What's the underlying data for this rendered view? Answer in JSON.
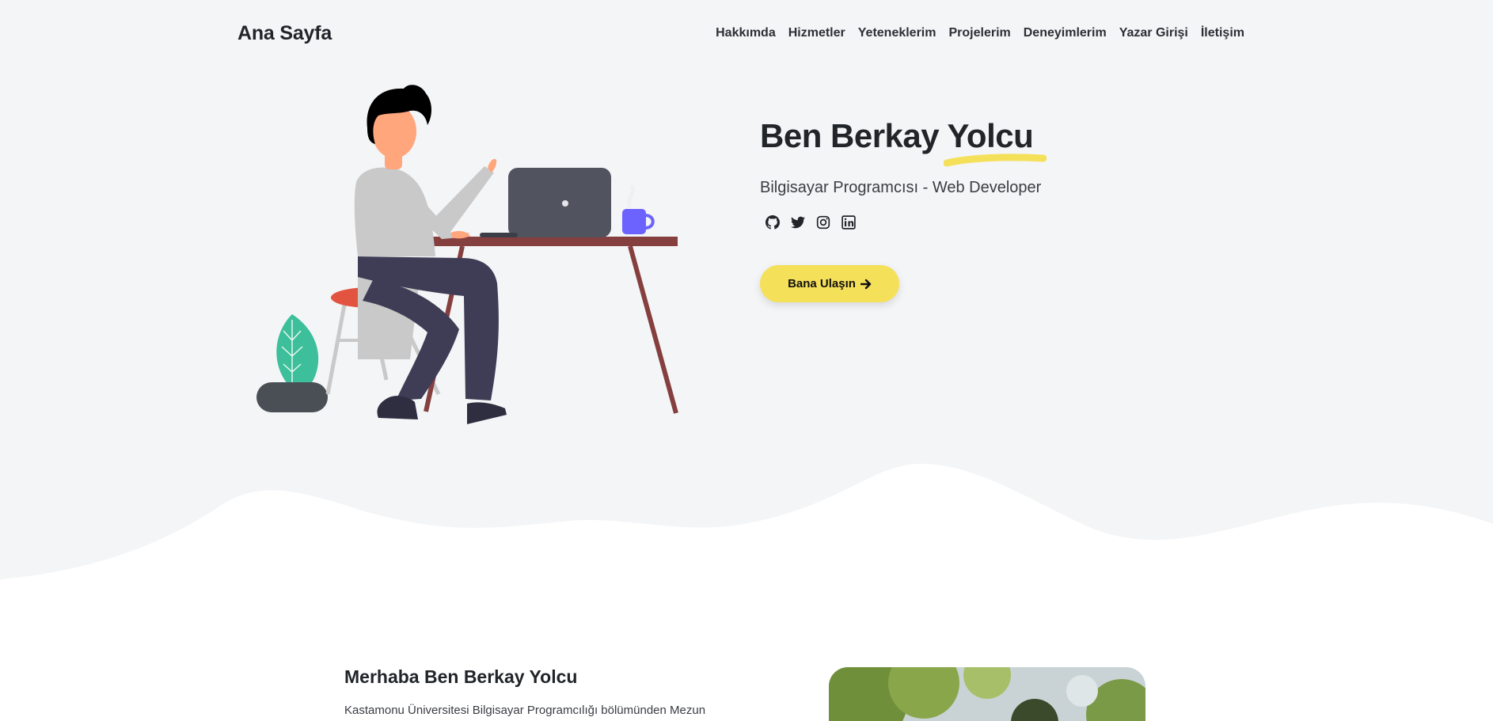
{
  "navbar": {
    "brand": "Ana Sayfa",
    "links": [
      "Hakkımda",
      "Hizmetler",
      "Yeteneklerim",
      "Projelerim",
      "Deneyimlerim",
      "Yazar Girişi",
      "İletişim"
    ]
  },
  "hero": {
    "name": "Ben Berkay Yolcu",
    "subtitle": "Bilgisayar Programcısı - Web Developer",
    "social_icons": [
      "github-icon",
      "twitter-icon",
      "instagram-icon",
      "linkedin-icon"
    ],
    "cta_label": "Bana Ulaşın",
    "cta_icon": "arrow-right-icon",
    "accent_color": "#f5e05a",
    "background_color": "#f4f5f7"
  },
  "about": {
    "title": "Merhaba Ben Berkay Yolcu",
    "text": "Kastamonu Üniversitesi Bilgisayar Programcılığı bölümünden Mezun"
  }
}
